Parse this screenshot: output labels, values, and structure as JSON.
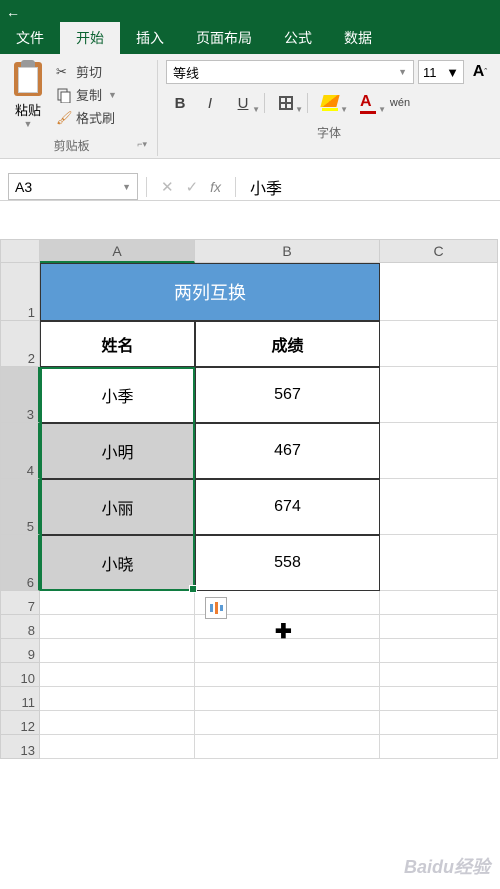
{
  "tabs": [
    "文件",
    "开始",
    "插入",
    "页面布局",
    "公式",
    "数据"
  ],
  "active_tab": 1,
  "clipboard": {
    "paste": "粘贴",
    "cut": "剪切",
    "copy": "复制",
    "format_painter": "格式刷",
    "group_label": "剪贴板"
  },
  "font": {
    "family": "等线",
    "size": "11",
    "bold": "B",
    "italic": "I",
    "underline": "U",
    "group_label": "字体",
    "color_letter": "A",
    "inc_letter": "A"
  },
  "name_box": "A3",
  "formula_value": "小季",
  "columns": [
    "A",
    "B",
    "C"
  ],
  "rows": [
    "1",
    "2",
    "3",
    "4",
    "5",
    "6",
    "7",
    "8",
    "9",
    "10",
    "11",
    "12",
    "13"
  ],
  "sheet": {
    "title": "两列互换",
    "header_a": "姓名",
    "header_b": "成绩",
    "data": [
      {
        "name": "小季",
        "score": "567"
      },
      {
        "name": "小明",
        "score": "467"
      },
      {
        "name": "小丽",
        "score": "674"
      },
      {
        "name": "小晓",
        "score": "558"
      }
    ]
  },
  "watermark": "Baidu经验",
  "chart_data": {
    "type": "table",
    "title": "两列互换",
    "columns": [
      "姓名",
      "成绩"
    ],
    "rows": [
      [
        "小季",
        567
      ],
      [
        "小明",
        467
      ],
      [
        "小丽",
        674
      ],
      [
        "小晓",
        558
      ]
    ]
  }
}
